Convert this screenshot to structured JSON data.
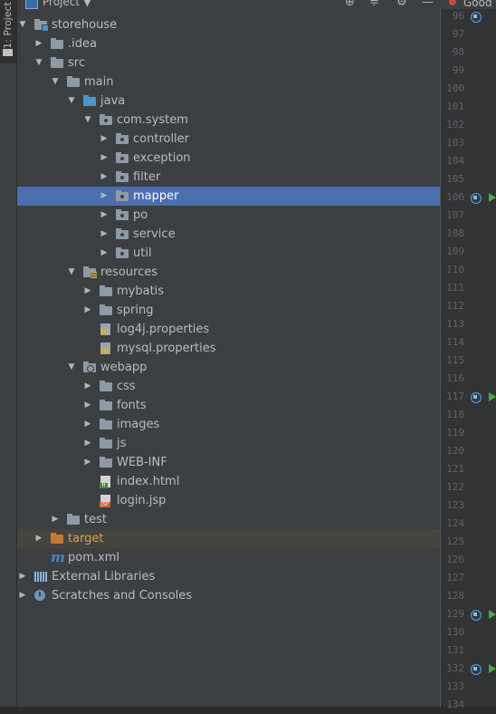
{
  "panel": {
    "side_tab_label": "1: Project",
    "header_title": "Project ▼",
    "header_icons": [
      "crosshair-icon",
      "collapse-icon",
      "gear-icon",
      "minimize-icon"
    ]
  },
  "editor_tab_label": "Good",
  "tree": [
    {
      "id": "storehouse",
      "label": "storehouse",
      "depth": 0,
      "arrow": "down",
      "icon": "module-folder",
      "name": "tree-item-storehouse"
    },
    {
      "id": "idea",
      "label": ".idea",
      "depth": 1,
      "arrow": "right",
      "icon": "folder",
      "name": "tree-item-idea"
    },
    {
      "id": "src",
      "label": "src",
      "depth": 1,
      "arrow": "down",
      "icon": "folder",
      "name": "tree-item-src"
    },
    {
      "id": "main",
      "label": "main",
      "depth": 2,
      "arrow": "down",
      "icon": "folder",
      "name": "tree-item-main"
    },
    {
      "id": "java",
      "label": "java",
      "depth": 3,
      "arrow": "down",
      "icon": "source-folder",
      "name": "tree-item-java"
    },
    {
      "id": "comsystem",
      "label": "com.system",
      "depth": 4,
      "arrow": "down",
      "icon": "package",
      "name": "tree-item-com-system"
    },
    {
      "id": "controller",
      "label": "controller",
      "depth": 5,
      "arrow": "right",
      "icon": "package",
      "name": "tree-item-controller"
    },
    {
      "id": "exception",
      "label": "exception",
      "depth": 5,
      "arrow": "right",
      "icon": "package",
      "name": "tree-item-exception"
    },
    {
      "id": "filter",
      "label": "filter",
      "depth": 5,
      "arrow": "right",
      "icon": "package",
      "name": "tree-item-filter"
    },
    {
      "id": "mapper",
      "label": "mapper",
      "depth": 5,
      "arrow": "right",
      "icon": "package",
      "name": "tree-item-mapper",
      "selected": true
    },
    {
      "id": "po",
      "label": "po",
      "depth": 5,
      "arrow": "right",
      "icon": "package",
      "name": "tree-item-po"
    },
    {
      "id": "service",
      "label": "service",
      "depth": 5,
      "arrow": "right",
      "icon": "package",
      "name": "tree-item-service"
    },
    {
      "id": "util",
      "label": "util",
      "depth": 5,
      "arrow": "right",
      "icon": "package",
      "name": "tree-item-util"
    },
    {
      "id": "resources",
      "label": "resources",
      "depth": 3,
      "arrow": "down",
      "icon": "resources-folder",
      "name": "tree-item-resources"
    },
    {
      "id": "mybatis",
      "label": "mybatis",
      "depth": 4,
      "arrow": "right",
      "icon": "folder",
      "name": "tree-item-mybatis"
    },
    {
      "id": "spring",
      "label": "spring",
      "depth": 4,
      "arrow": "right",
      "icon": "folder",
      "name": "tree-item-spring"
    },
    {
      "id": "log4j",
      "label": "log4j.properties",
      "depth": 4,
      "arrow": "none",
      "icon": "properties-file",
      "name": "tree-item-log4j-properties"
    },
    {
      "id": "mysql",
      "label": "mysql.properties",
      "depth": 4,
      "arrow": "none",
      "icon": "properties-file",
      "name": "tree-item-mysql-properties"
    },
    {
      "id": "webapp",
      "label": "webapp",
      "depth": 3,
      "arrow": "down",
      "icon": "web-folder",
      "name": "tree-item-webapp"
    },
    {
      "id": "css",
      "label": "css",
      "depth": 4,
      "arrow": "right",
      "icon": "folder",
      "name": "tree-item-css"
    },
    {
      "id": "fonts",
      "label": "fonts",
      "depth": 4,
      "arrow": "right",
      "icon": "folder",
      "name": "tree-item-fonts"
    },
    {
      "id": "images",
      "label": "images",
      "depth": 4,
      "arrow": "right",
      "icon": "folder",
      "name": "tree-item-images"
    },
    {
      "id": "js",
      "label": "js",
      "depth": 4,
      "arrow": "right",
      "icon": "folder",
      "name": "tree-item-js"
    },
    {
      "id": "webinf",
      "label": "WEB-INF",
      "depth": 4,
      "arrow": "right",
      "icon": "folder",
      "name": "tree-item-web-inf"
    },
    {
      "id": "index",
      "label": "index.html",
      "depth": 4,
      "arrow": "none",
      "icon": "html-file",
      "name": "tree-item-index-html"
    },
    {
      "id": "login",
      "label": "login.jsp",
      "depth": 4,
      "arrow": "none",
      "icon": "jsp-file",
      "name": "tree-item-login-jsp"
    },
    {
      "id": "test",
      "label": "test",
      "depth": 2,
      "arrow": "right",
      "icon": "folder",
      "name": "tree-item-test"
    },
    {
      "id": "target",
      "label": "target",
      "depth": 1,
      "arrow": "right",
      "icon": "excluded-folder",
      "name": "tree-item-target",
      "dim": true
    },
    {
      "id": "pom",
      "label": "pom.xml",
      "depth": 1,
      "arrow": "none",
      "icon": "maven-file",
      "name": "tree-item-pom-xml"
    },
    {
      "id": "extlibs",
      "label": "External Libraries",
      "depth": 0,
      "arrow": "right",
      "icon": "libraries",
      "name": "tree-item-external-libraries"
    },
    {
      "id": "scratches",
      "label": "Scratches and Consoles",
      "depth": 0,
      "arrow": "right",
      "icon": "scratches",
      "name": "tree-item-scratches-and-consoles"
    }
  ],
  "gutter": {
    "line_numbers": [
      "96",
      "97",
      "98",
      "99",
      "100",
      "101",
      "102",
      "103",
      "104",
      "105",
      "106",
      "107",
      "108",
      "109",
      "110",
      "111",
      "112",
      "113",
      "114",
      "115",
      "116",
      "117",
      "118",
      "119",
      "120",
      "121",
      "122",
      "123",
      "124",
      "125",
      "126",
      "127",
      "128",
      "129",
      "130",
      "131",
      "132",
      "133",
      "134"
    ],
    "markers": [
      "96",
      "106",
      "117",
      "129",
      "132"
    ],
    "run_markers": [
      "106",
      "117",
      "129",
      "132"
    ]
  }
}
